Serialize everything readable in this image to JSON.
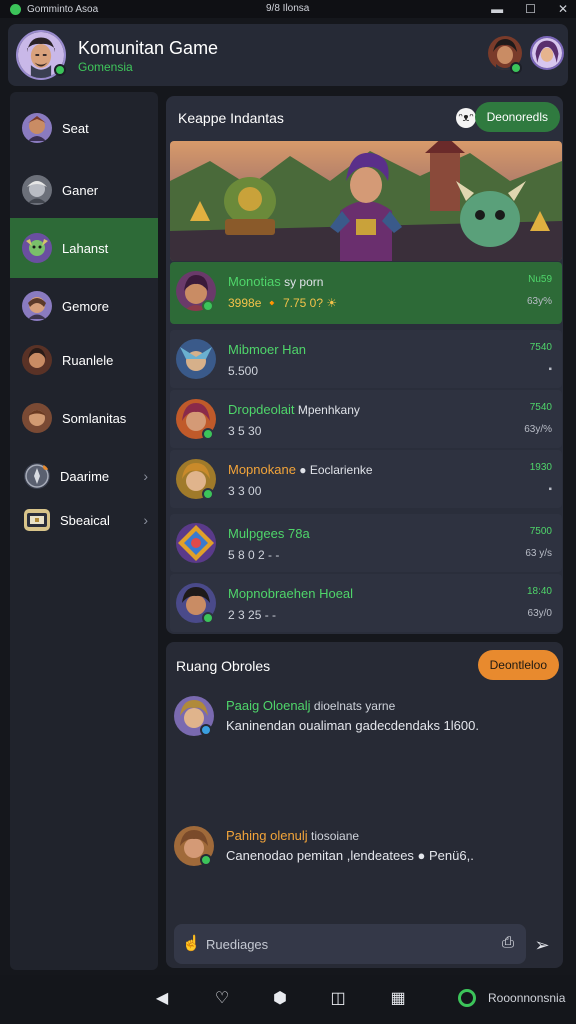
{
  "statusbar": {
    "app_name": "Gomminto Asoa",
    "center_text": "9/8 Ilonsa",
    "controls": {
      "minimize": "▬",
      "maximize": "☐",
      "close": "✕"
    }
  },
  "header": {
    "title": "Komunitan Game",
    "subtitle": "Gomensia"
  },
  "sidebar": {
    "items": [
      {
        "label": "Seat",
        "icon": "avatar-icon"
      },
      {
        "label": "Ganer",
        "icon": "avatar-icon"
      },
      {
        "label": "Lahanst",
        "icon": "avatar-icon",
        "active": true
      },
      {
        "label": "Gemore",
        "icon": "avatar-icon"
      },
      {
        "label": "Ruanlele",
        "icon": "avatar-icon"
      },
      {
        "label": "Somlanitas",
        "icon": "avatar-icon"
      },
      {
        "label": "Daarime",
        "icon": "compass-icon",
        "chevron": "›"
      },
      {
        "label": "Sbeaical",
        "icon": "chest-icon",
        "chevron": "›"
      }
    ]
  },
  "panel": {
    "title": "Keappe Indantas",
    "ghost_glyph": "ᵔᴥᵔ",
    "button": "Deonoredls"
  },
  "rows": [
    {
      "name": "Monotias",
      "extra": " sy porn",
      "sub": "3998e 🔸 7.75 0? ☀",
      "time": "Nu59",
      "meta": "63y%",
      "featured": true
    },
    {
      "name": "Mibmoer Han",
      "extra": "",
      "sub": "5.500",
      "time": "7540",
      "meta": "▪"
    },
    {
      "name": "Dropdeolait",
      "extra": " Mpenhkany",
      "sub": "3 5 30",
      "time": "7540",
      "meta": "63y/%"
    },
    {
      "name": "Mopnokane",
      "extra": " ● Eoclarienke",
      "sub": "3 3 00",
      "time": "1930",
      "meta": "▪",
      "orange": true
    },
    {
      "name": "Mulpgees 78a",
      "extra": "",
      "sub": "5 8 0 2 - -",
      "time": "7500",
      "meta": "63 y/s"
    },
    {
      "name": "Mopnobraehen Hoeal",
      "extra": "",
      "sub": "2 3 25 - -",
      "time": "18:40",
      "meta": "63y/0"
    }
  ],
  "chat": {
    "title": "Ruang Obroles",
    "button": "Deontleloo",
    "messages": [
      {
        "name": "Paaig Oloenalj",
        "extra": " dioelnats yarne",
        "text": "Kaninendan oualiman gadecdendaks 1l600.",
        "orange": false
      },
      {
        "name": "Pahing olenulj",
        "extra": " tiosoiane",
        "text": "Canenodao pemitan ,lendeatees ● Penü6,.",
        "orange": true
      }
    ],
    "input_placeholder": "Ruediages"
  },
  "navbar": {
    "icons": [
      "◀",
      "♡",
      "⬢",
      "◫",
      "▦"
    ],
    "status_label": "Rooonnonsnia"
  },
  "colors": {
    "accent_green": "#2f7a3f",
    "text_green": "#4fd56a",
    "accent_orange": "#e88a2e",
    "panel_bg": "#2a2e3b"
  }
}
